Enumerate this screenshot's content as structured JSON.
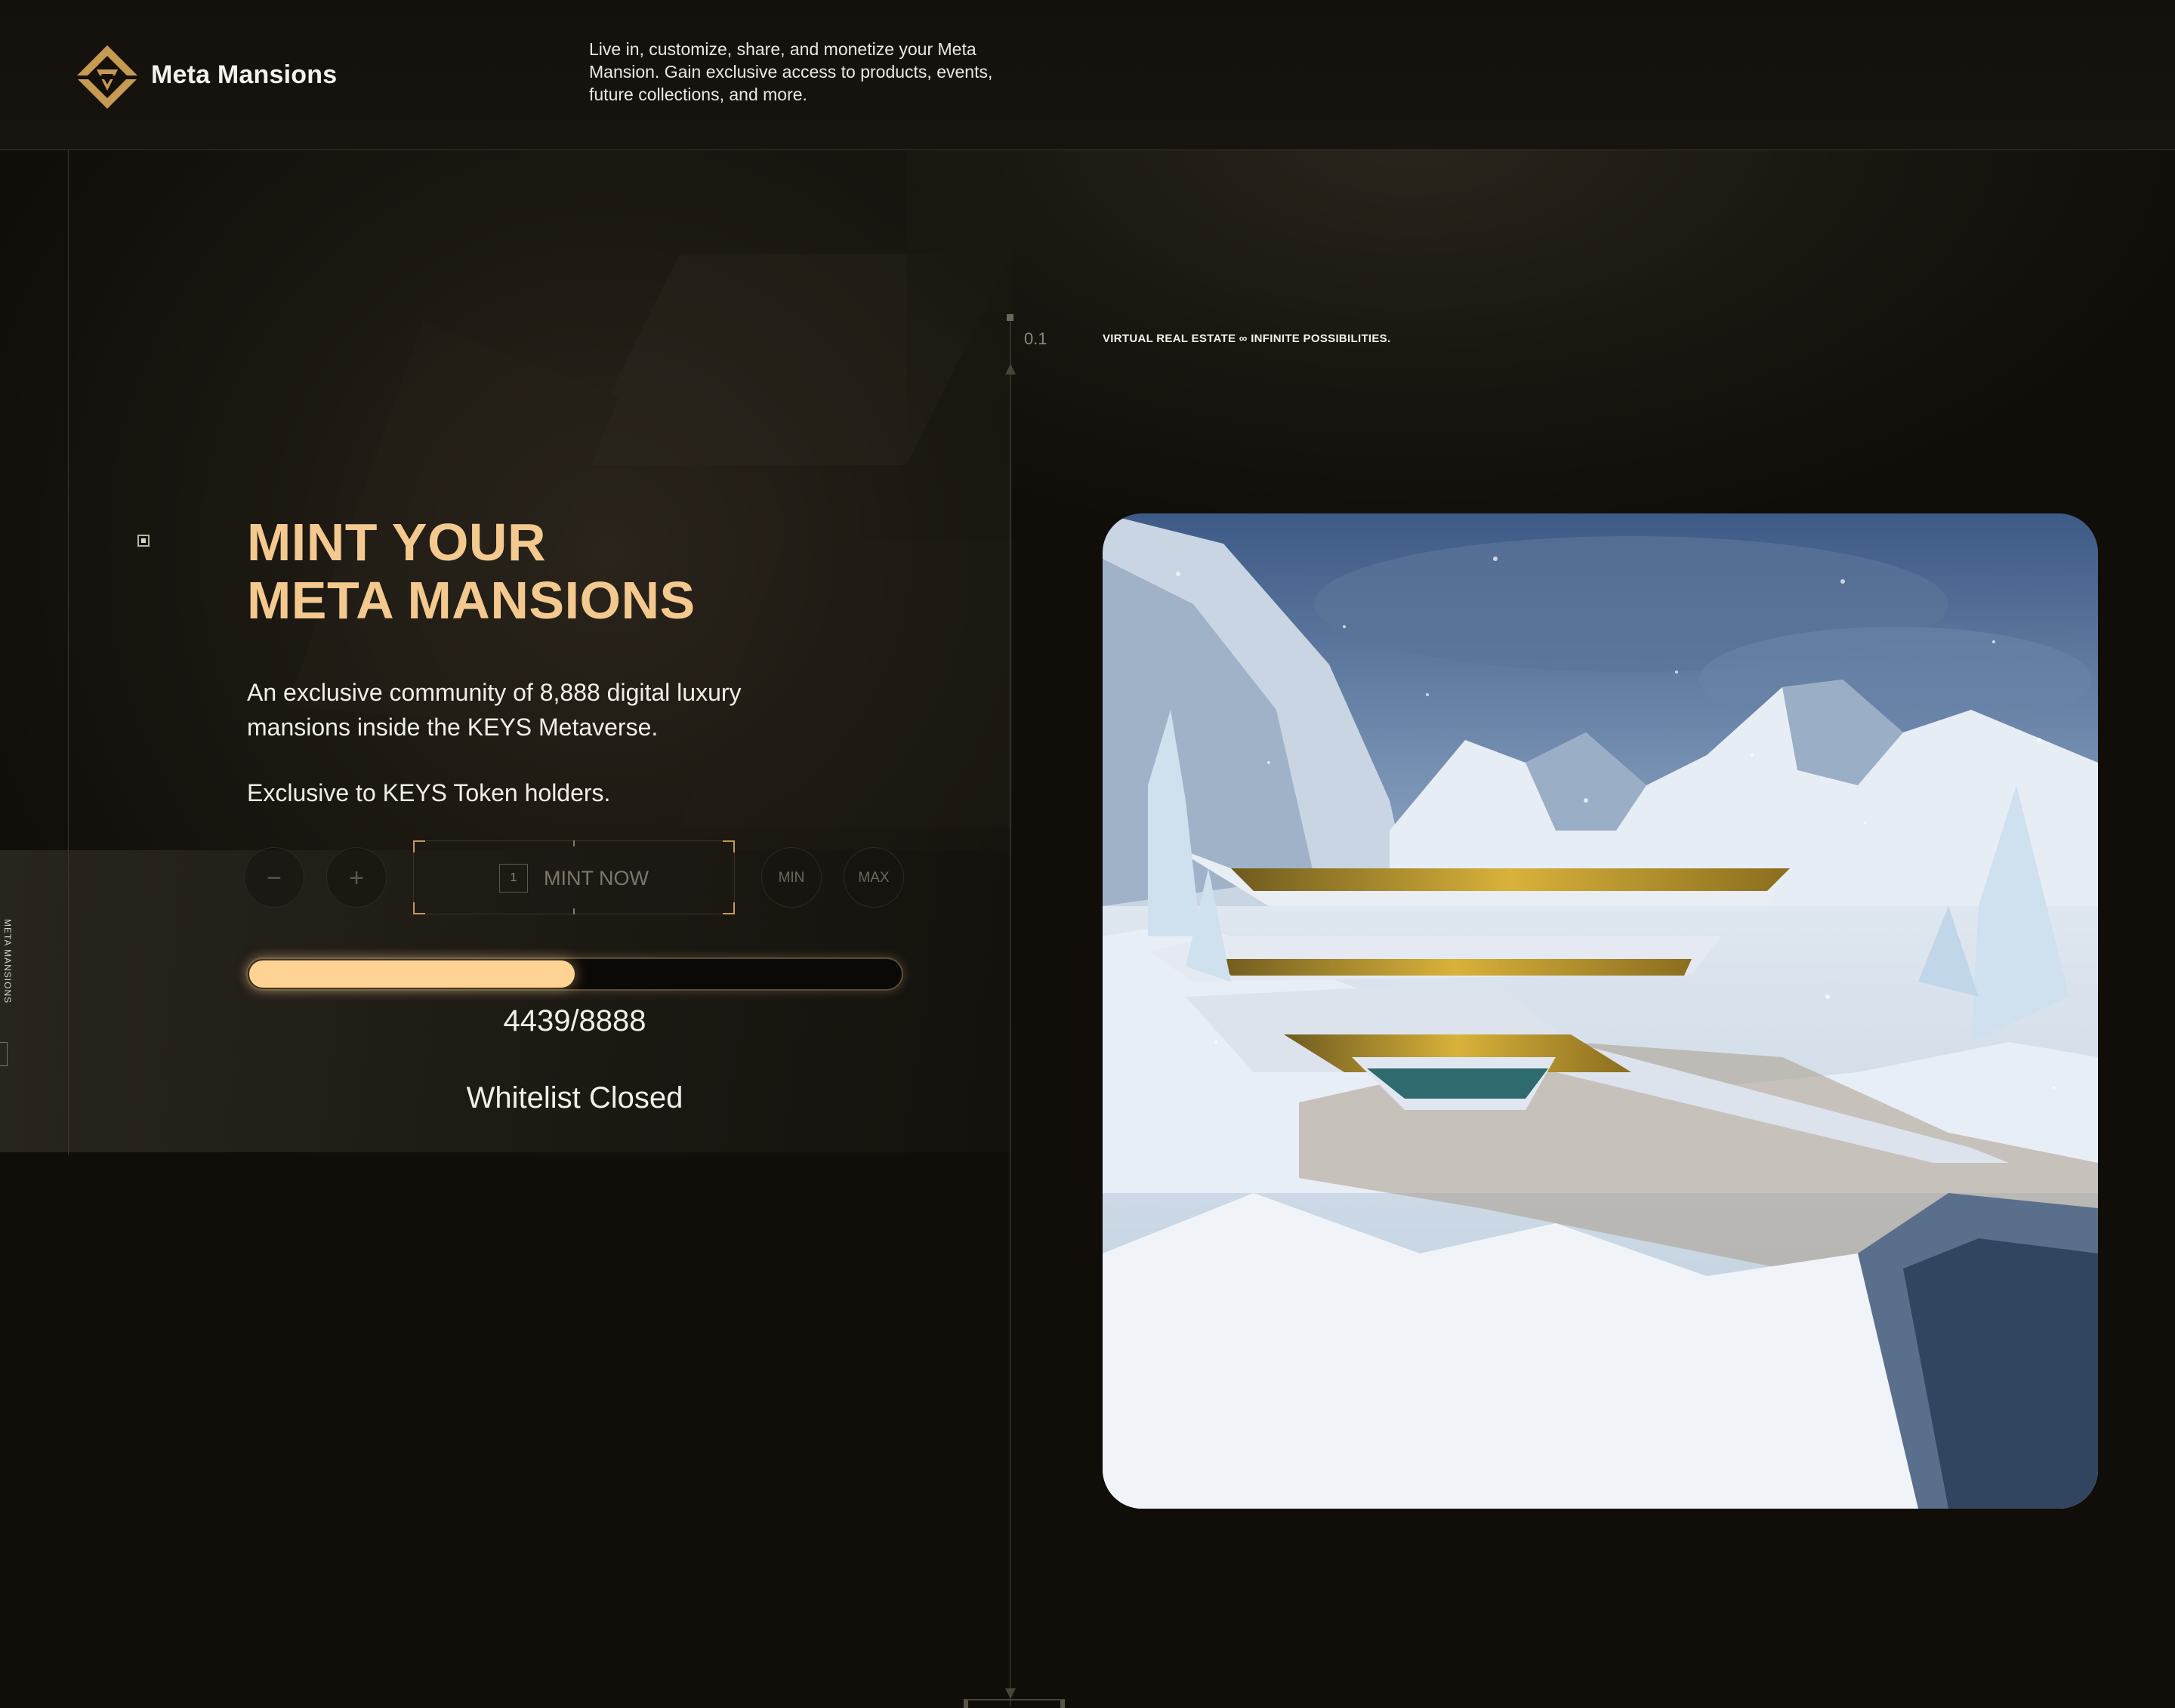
{
  "header": {
    "brand": "Meta Mansions",
    "tagline": "Live in, customize, share, and monetize your Meta Mansion. Gain exclusive access to products, events, future collections, and more."
  },
  "side": {
    "vertical_label": "META MANSIONS"
  },
  "section": {
    "number": "0.1",
    "tag": "VIRTUAL REAL ESTATE ∞ INFINITE POSSIBILITIES."
  },
  "hero": {
    "title_line1": "MINT YOUR",
    "title_line2": "META MANSIONS",
    "description": "An exclusive community of 8,888 digital luxury mansions inside the KEYS Metaverse.",
    "exclusive": "Exclusive to KEYS Token holders."
  },
  "mint": {
    "minus_label": "−",
    "plus_label": "+",
    "quantity": "1",
    "button_label": "MINT NOW",
    "min_label": "MIN",
    "max_label": "MAX"
  },
  "progress": {
    "minted": 4439,
    "total": 8888,
    "text": "4439/8888",
    "fill_fraction": 0.4994
  },
  "status": {
    "text": "Whitelist Closed"
  },
  "image": {
    "alt": "snowy-mansion-render"
  },
  "colors": {
    "background": "#110e0a",
    "accent": "#f4c98f",
    "progress_fill": "#ffd393",
    "logo_gold": "#c79a52"
  }
}
